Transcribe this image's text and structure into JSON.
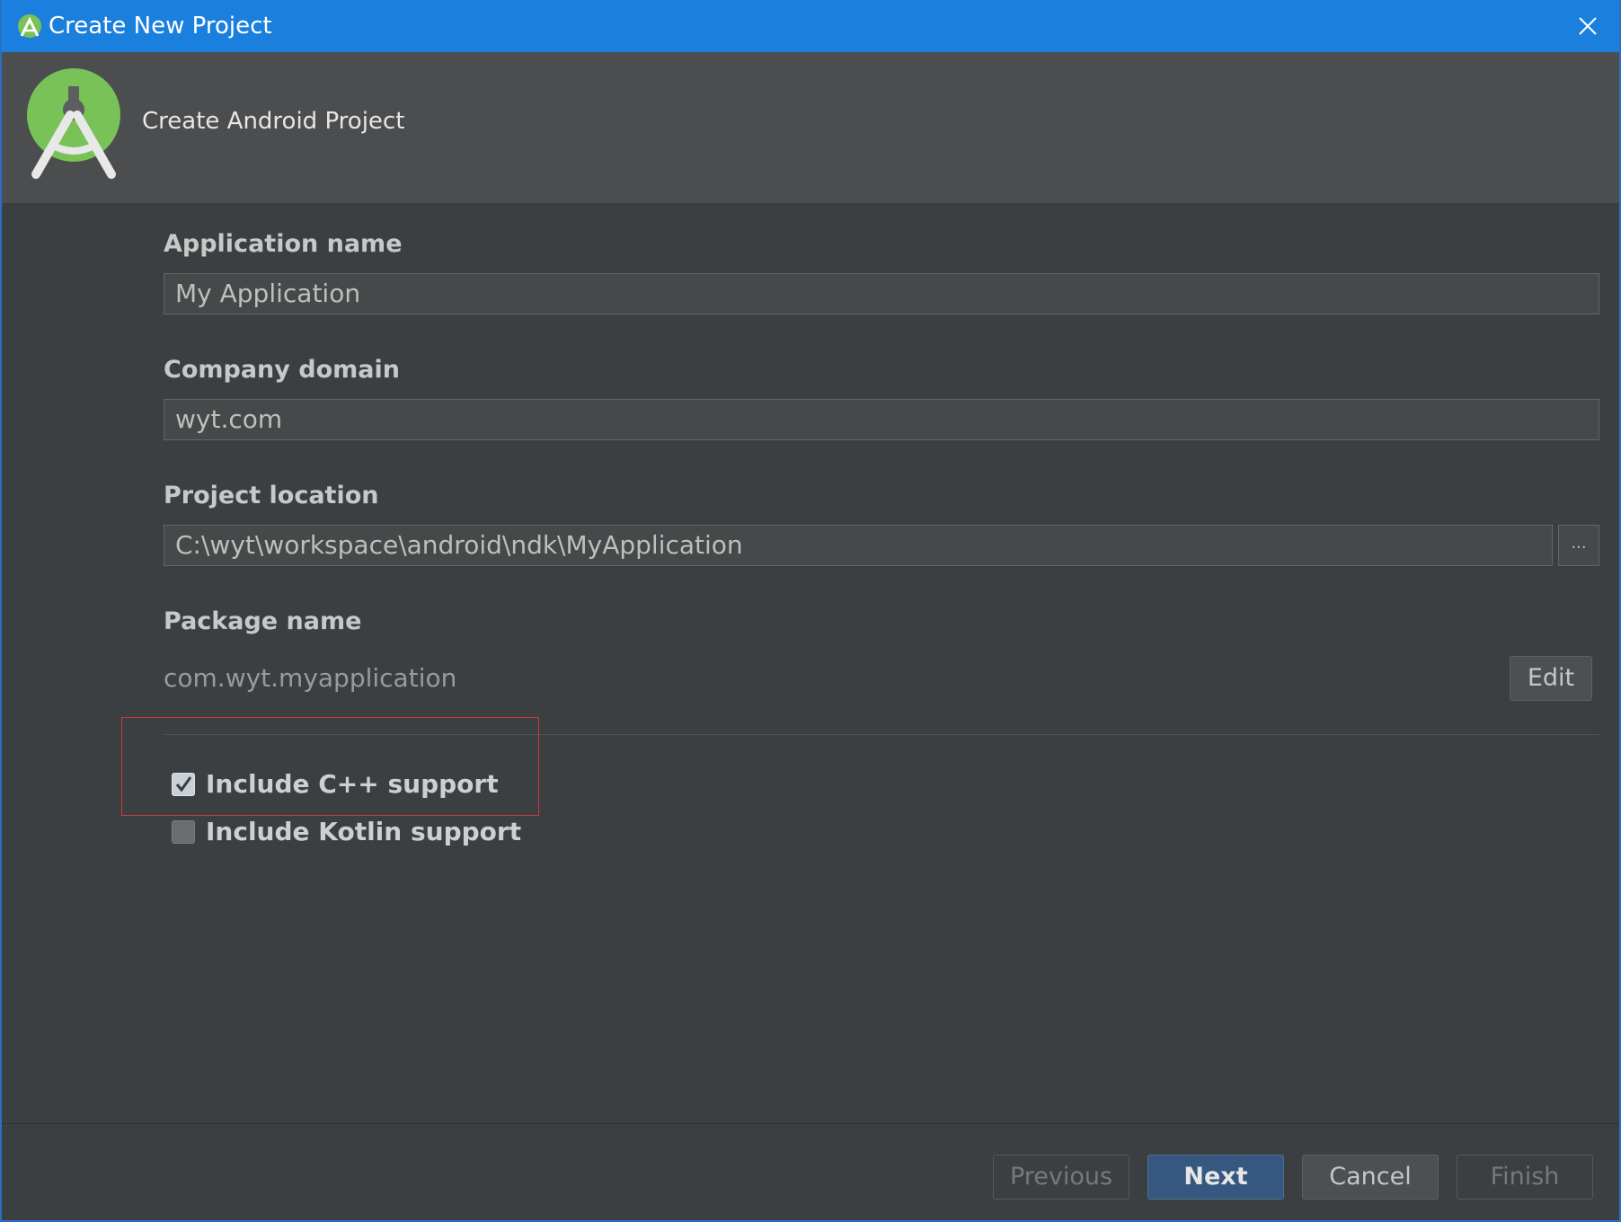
{
  "window": {
    "title": "Create New Project"
  },
  "header": {
    "heading": "Create Android Project"
  },
  "form": {
    "app_name_label": "Application name",
    "app_name_value": "My Application",
    "company_domain_label": "Company domain",
    "company_domain_value": "wyt.com",
    "project_location_label": "Project location",
    "project_location_value": "C:\\wyt\\workspace\\android\\ndk\\MyApplication",
    "browse_label": "...",
    "package_name_label": "Package name",
    "package_name_value": "com.wyt.myapplication",
    "edit_label": "Edit"
  },
  "options": [
    {
      "label": "Include C++ support",
      "checked": true
    },
    {
      "label": "Include Kotlin support",
      "checked": false
    }
  ],
  "footer": {
    "previous_label": "Previous",
    "next_label": "Next",
    "cancel_label": "Cancel",
    "finish_label": "Finish"
  },
  "colors": {
    "titlebar": "#1b80dd",
    "background": "#3c3f41",
    "header_band": "#4b4d4f",
    "highlight_box": "#c93b3b",
    "primary_button": "#365880",
    "android_green": "#78c257"
  }
}
